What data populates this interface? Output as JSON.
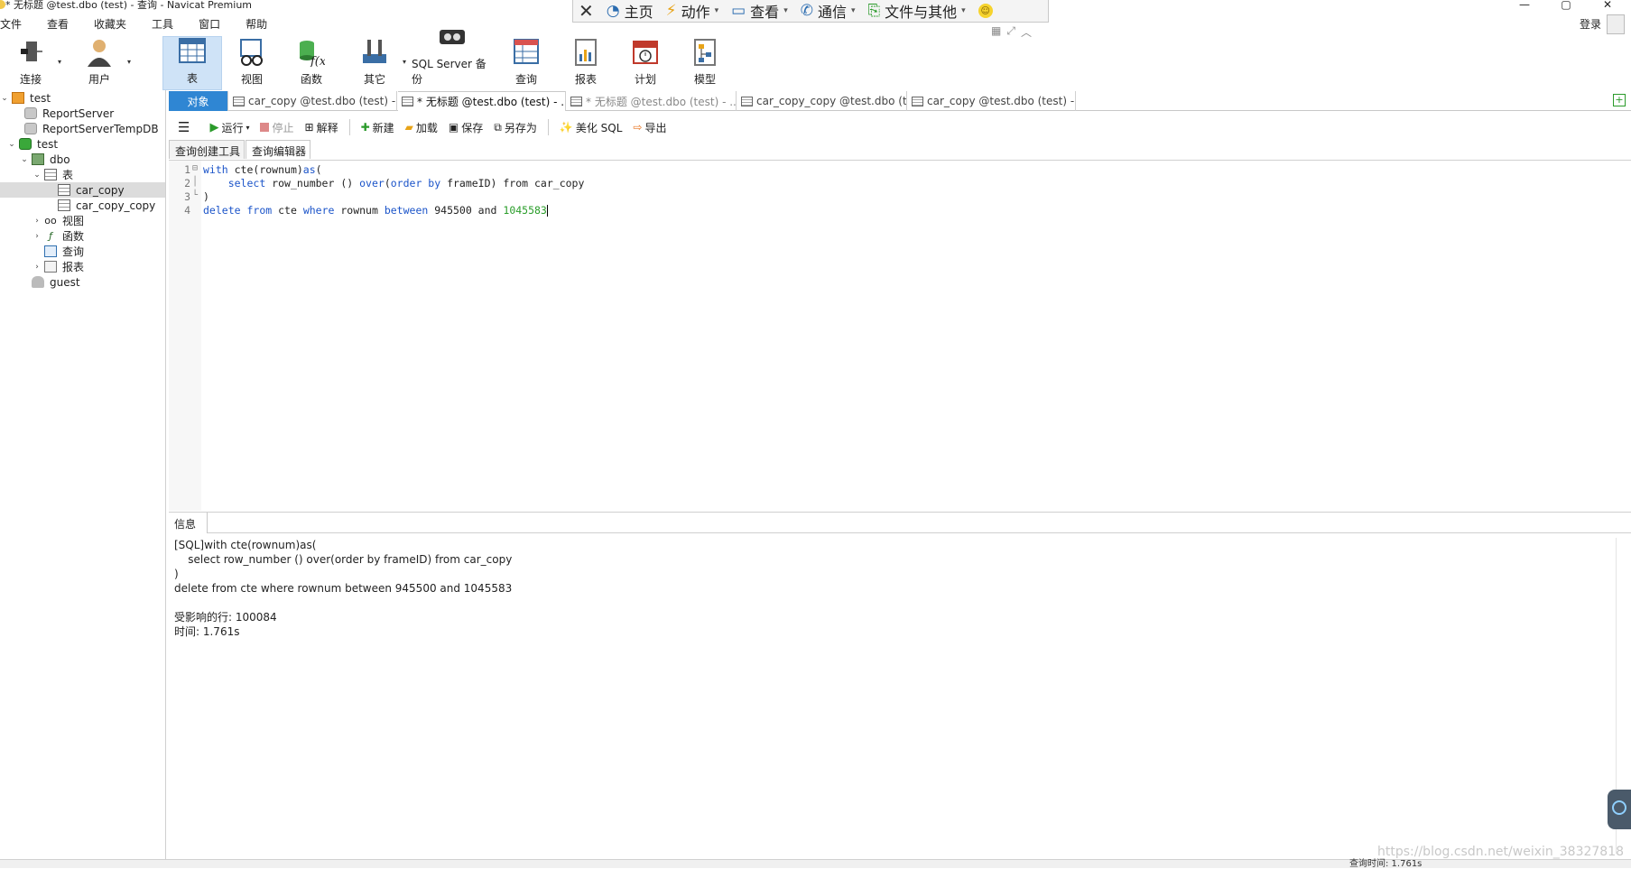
{
  "window": {
    "title": "* 无标题 @test.dbo (test) - 查询 - Navicat Premium",
    "controls": {
      "minimize": "—",
      "maximize": "▢",
      "close": "✕"
    }
  },
  "remote_bar": {
    "items": [
      {
        "label": "主页",
        "icon": "home-icon"
      },
      {
        "label": "动作",
        "icon": "lightning-icon"
      },
      {
        "label": "查看",
        "icon": "monitor-icon"
      },
      {
        "label": "通信",
        "icon": "phone-icon"
      },
      {
        "label": "文件与其他",
        "icon": "file-transfer-icon"
      }
    ]
  },
  "menubar": {
    "items": [
      "文件",
      "查看",
      "收藏夹",
      "工具",
      "窗口",
      "帮助"
    ]
  },
  "login": "登录",
  "toolbar": {
    "buttons": [
      {
        "label": "连接",
        "icon": "plug-icon",
        "has_dropdown": true
      },
      {
        "label": "用户",
        "icon": "user-icon",
        "has_dropdown": true
      },
      {
        "label": "表",
        "icon": "table-icon",
        "active": true
      },
      {
        "label": "视图",
        "icon": "view-glasses-icon"
      },
      {
        "label": "函数",
        "icon": "function-icon"
      },
      {
        "label": "其它",
        "icon": "tools-icon",
        "has_dropdown": true
      },
      {
        "label": "SQL Server 备份",
        "icon": "backup-icon"
      },
      {
        "label": "查询",
        "icon": "query-icon"
      },
      {
        "label": "报表",
        "icon": "report-icon"
      },
      {
        "label": "计划",
        "icon": "calendar-icon"
      },
      {
        "label": "模型",
        "icon": "model-icon"
      }
    ]
  },
  "sidebar": {
    "tree": [
      {
        "label": "test"
      },
      {
        "label": "ReportServer"
      },
      {
        "label": "ReportServerTempDB"
      },
      {
        "label": "test"
      },
      {
        "label": "dbo"
      },
      {
        "label": "表"
      },
      {
        "label": "car_copy",
        "selected": true
      },
      {
        "label": "car_copy_copy"
      },
      {
        "label": "视图"
      },
      {
        "label": "函数"
      },
      {
        "label": "查询"
      },
      {
        "label": "报表"
      },
      {
        "label": "guest"
      }
    ]
  },
  "doc_tabs": [
    {
      "label": "对象"
    },
    {
      "label": "car_copy @test.dbo (test) - ..."
    },
    {
      "label": "* 无标题 @test.dbo (test) - ...",
      "active": true
    },
    {
      "label": "* 无标题 @test.dbo (test) - ..."
    },
    {
      "label": "car_copy_copy @test.dbo (t..."
    },
    {
      "label": "car_copy @test.dbo (test) - ..."
    }
  ],
  "query_toolbar": {
    "run": "运行",
    "stop": "停止",
    "explain": "解释",
    "new": "新建",
    "load": "加载",
    "save": "保存",
    "save_as": "另存为",
    "beautify": "美化 SQL",
    "export": "导出"
  },
  "sub_tabs": [
    "查询创建工具",
    "查询编辑器"
  ],
  "editor": {
    "line_numbers": [
      "1",
      "2",
      "3",
      "4"
    ],
    "l1": {
      "kw1": "with",
      "t1": " cte(rownum)",
      "kw2": "as",
      "t2": "("
    },
    "l2": {
      "indent": "    ",
      "kw1": "select",
      "t1": " row_number () ",
      "kw2": "over",
      "t2": "(",
      "kw3": "order by",
      "t3": " frameID) from car_copy"
    },
    "l3": {
      "t1": ")"
    },
    "l4": {
      "kw1": "delete",
      "s1": " ",
      "kw2": "from",
      "t1": " cte ",
      "kw3": "where",
      "t2": " rownum ",
      "kw4": "between",
      "t3": " 945500 and ",
      "num": "1045583"
    }
  },
  "info": {
    "tab": "信息",
    "lines": [
      "[SQL]with cte(rownum)as(",
      "    select row_number () over(order by frameID) from car_copy",
      ")",
      "delete from cte where rownum between 945500 and 1045583",
      "",
      "受影响的行: 100084",
      "时间: 1.761s"
    ]
  },
  "statusbar": {
    "query_time": "查询时间: 1.761s"
  },
  "watermark": "https://blog.csdn.net/weixin_38327818"
}
